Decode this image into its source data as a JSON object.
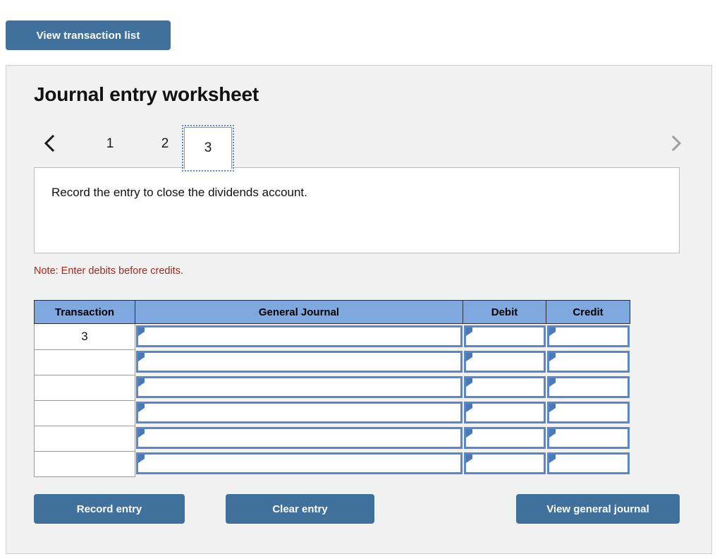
{
  "toolbar": {
    "view_transaction_list_label": "View transaction list"
  },
  "worksheet": {
    "title": "Journal entry worksheet",
    "pager": {
      "prev_icon": "chevron-left-icon",
      "next_icon": "chevron-right-icon",
      "tabs": [
        "1",
        "2",
        "3"
      ],
      "active_tab": "3"
    },
    "instruction": "Record the entry to close the dividends account.",
    "note": "Note: Enter debits before credits."
  },
  "table": {
    "headers": [
      "Transaction",
      "General Journal",
      "Debit",
      "Credit"
    ],
    "rows": [
      {
        "transaction": "3",
        "general_journal": "",
        "debit": "",
        "credit": ""
      },
      {
        "transaction": "",
        "general_journal": "",
        "debit": "",
        "credit": ""
      },
      {
        "transaction": "",
        "general_journal": "",
        "debit": "",
        "credit": ""
      },
      {
        "transaction": "",
        "general_journal": "",
        "debit": "",
        "credit": ""
      },
      {
        "transaction": "",
        "general_journal": "",
        "debit": "",
        "credit": ""
      },
      {
        "transaction": "",
        "general_journal": "",
        "debit": "",
        "credit": ""
      }
    ]
  },
  "actions": {
    "record_entry_label": "Record entry",
    "clear_entry_label": "Clear entry",
    "view_general_journal_label": "View general journal"
  },
  "colors": {
    "button_blue": "#40709c",
    "header_blue": "#7fa7e0",
    "input_border_blue": "#5b87c4",
    "note_red": "#9c2b21",
    "panel_bg": "#f1f1f1"
  }
}
